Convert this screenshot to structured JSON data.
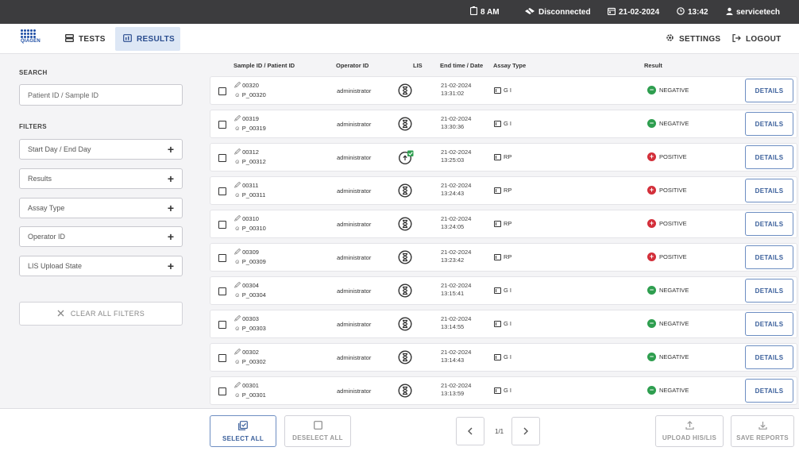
{
  "status_bar": {
    "battery": "8 AM",
    "network": "Disconnected",
    "date": "21-02-2024",
    "time": "13:42",
    "user": "servicetech"
  },
  "nav": {
    "logo_text": "QIAGEN",
    "tests_label": "TESTS",
    "results_label": "RESULTS",
    "settings_label": "SETTINGS",
    "logout_label": "LOGOUT"
  },
  "sidebar": {
    "search_label": "SEARCH",
    "search_placeholder": "Patient ID / Sample ID",
    "filters_label": "FILTERS",
    "filters": [
      {
        "label": "Start Day / End Day"
      },
      {
        "label": "Results"
      },
      {
        "label": "Assay Type"
      },
      {
        "label": "Operator ID"
      },
      {
        "label": "LIS Upload State"
      }
    ],
    "clear_label": "CLEAR ALL FILTERS"
  },
  "table": {
    "headers": {
      "sample": "Sample ID / Patient ID",
      "operator": "Operator ID",
      "lis": "LIS",
      "endtime": "End time / Date",
      "assay": "Assay Type",
      "result": "Result"
    },
    "details_label": "DETAILS",
    "rows": [
      {
        "sample_id": "00320",
        "patient_id": "P_00320",
        "operator": "administrator",
        "lis": "pending",
        "date": "21-02-2024",
        "time": "13:31:02",
        "assay": "G I",
        "result": "NEGATIVE"
      },
      {
        "sample_id": "00319",
        "patient_id": "P_00319",
        "operator": "administrator",
        "lis": "pending",
        "date": "21-02-2024",
        "time": "13:30:36",
        "assay": "G I",
        "result": "NEGATIVE"
      },
      {
        "sample_id": "00312",
        "patient_id": "P_00312",
        "operator": "administrator",
        "lis": "uploaded",
        "date": "21-02-2024",
        "time": "13:25:03",
        "assay": "RP",
        "result": "POSITIVE"
      },
      {
        "sample_id": "00311",
        "patient_id": "P_00311",
        "operator": "administrator",
        "lis": "pending",
        "date": "21-02-2024",
        "time": "13:24:43",
        "assay": "RP",
        "result": "POSITIVE"
      },
      {
        "sample_id": "00310",
        "patient_id": "P_00310",
        "operator": "administrator",
        "lis": "pending",
        "date": "21-02-2024",
        "time": "13:24:05",
        "assay": "RP",
        "result": "POSITIVE"
      },
      {
        "sample_id": "00309",
        "patient_id": "P_00309",
        "operator": "administrator",
        "lis": "pending",
        "date": "21-02-2024",
        "time": "13:23:42",
        "assay": "RP",
        "result": "POSITIVE"
      },
      {
        "sample_id": "00304",
        "patient_id": "P_00304",
        "operator": "administrator",
        "lis": "pending",
        "date": "21-02-2024",
        "time": "13:15:41",
        "assay": "G I",
        "result": "NEGATIVE"
      },
      {
        "sample_id": "00303",
        "patient_id": "P_00303",
        "operator": "administrator",
        "lis": "pending",
        "date": "21-02-2024",
        "time": "13:14:55",
        "assay": "G I",
        "result": "NEGATIVE"
      },
      {
        "sample_id": "00302",
        "patient_id": "P_00302",
        "operator": "administrator",
        "lis": "pending",
        "date": "21-02-2024",
        "time": "13:14:43",
        "assay": "G I",
        "result": "NEGATIVE"
      },
      {
        "sample_id": "00301",
        "patient_id": "P_00301",
        "operator": "administrator",
        "lis": "pending",
        "date": "21-02-2024",
        "time": "13:13:59",
        "assay": "G I",
        "result": "NEGATIVE"
      }
    ]
  },
  "footer": {
    "select_all": "SELECT ALL",
    "deselect_all": "DESELECT ALL",
    "page": "1/1",
    "upload": "UPLOAD HIS/LIS",
    "save": "SAVE REPORTS"
  },
  "colors": {
    "negative": "#2e9e4f",
    "positive": "#d32f3a",
    "accent": "#3a5f9b"
  }
}
